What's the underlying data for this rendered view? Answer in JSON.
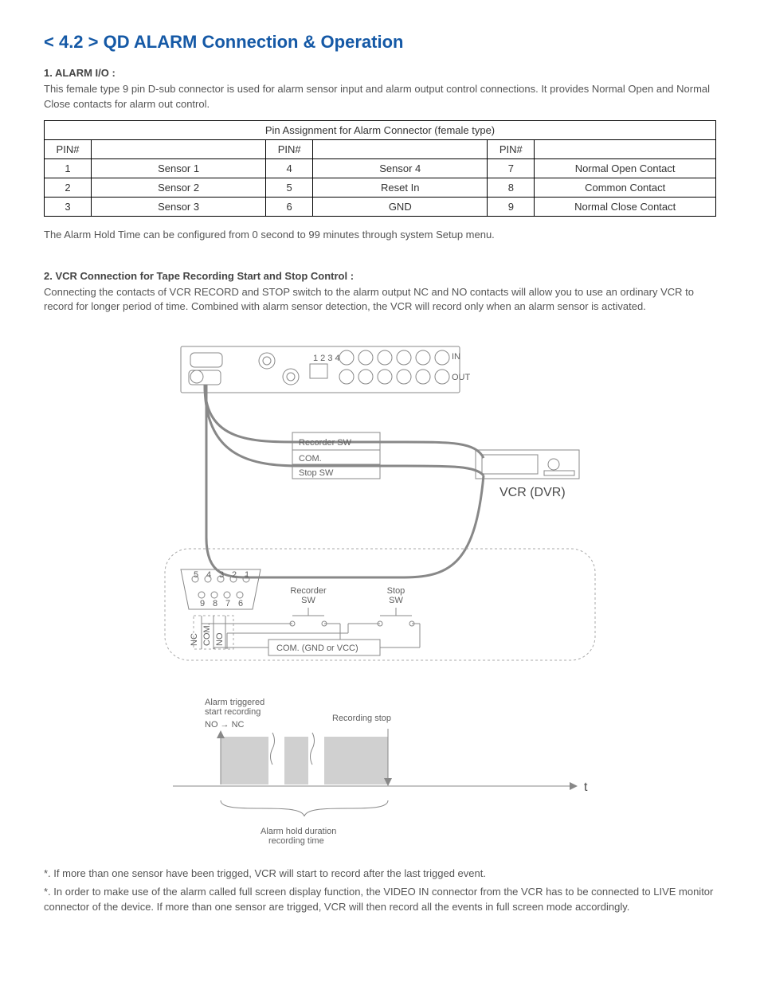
{
  "title": "< 4.2 > QD  ALARM Connection & Operation",
  "section1": {
    "head": "1.  ALARM I/O :",
    "para": "This female type 9 pin D-sub connector is used for alarm sensor input and alarm output control connections. It provides Normal Open and Normal Close contacts for alarm out control."
  },
  "pin_table": {
    "caption": "Pin Assignment for Alarm Connector (female type)",
    "head_pin": "PIN#",
    "rows": [
      {
        "p1": "1",
        "d1": "Sensor 1",
        "p2": "4",
        "d2": "Sensor 4",
        "p3": "7",
        "d3": "Normal Open Contact"
      },
      {
        "p1": "2",
        "d1": "Sensor 2",
        "p2": "5",
        "d2": "Reset In",
        "p3": "8",
        "d3": "Common Contact"
      },
      {
        "p1": "3",
        "d1": "Sensor 3",
        "p2": "6",
        "d2": "GND",
        "p3": "9",
        "d3": "Normal Close Contact"
      }
    ]
  },
  "hold_note": "The Alarm Hold Time can be configured from 0 second to 99 minutes through system Setup menu.",
  "section2": {
    "head": "2.  VCR Connection for Tape Recording Start and Stop Control :",
    "para": "Connecting the contacts of VCR RECORD and STOP switch to the alarm output NC and NO contacts will allow you to use an ordinary VCR to record for longer period of time. Combined with alarm sensor detection, the VCR will record only when an alarm sensor is activated."
  },
  "diagram_labels": {
    "recorder_sw": "Recorder SW",
    "com_top": "COM.",
    "stop_sw": "Stop SW",
    "vcr": "VCR (DVR)",
    "nc": "NC",
    "com_pin": "COM.",
    "no": "NO",
    "recorder_sw2": "Recorder\nSW",
    "stop_sw2": "Stop\nSW",
    "com_line": "COM. (GND or VCC)",
    "trig1": "Alarm triggered\nstart recording",
    "trig2": "NO → NC",
    "recstop": "Recording stop",
    "t_axis": "t",
    "hold_dur": "Alarm hold duration\nrecording time"
  },
  "footnotes": {
    "n1": "*. If more than one sensor have been trigged, VCR will start to record after the last trigged event.",
    "n2": "*. In order to make use of the alarm called full screen display function, the VIDEO IN connector from the VCR has to be connected to LIVE monitor connector of the device. If more than one sensor are trigged, VCR will then record all the events in full screen mode accordingly."
  }
}
